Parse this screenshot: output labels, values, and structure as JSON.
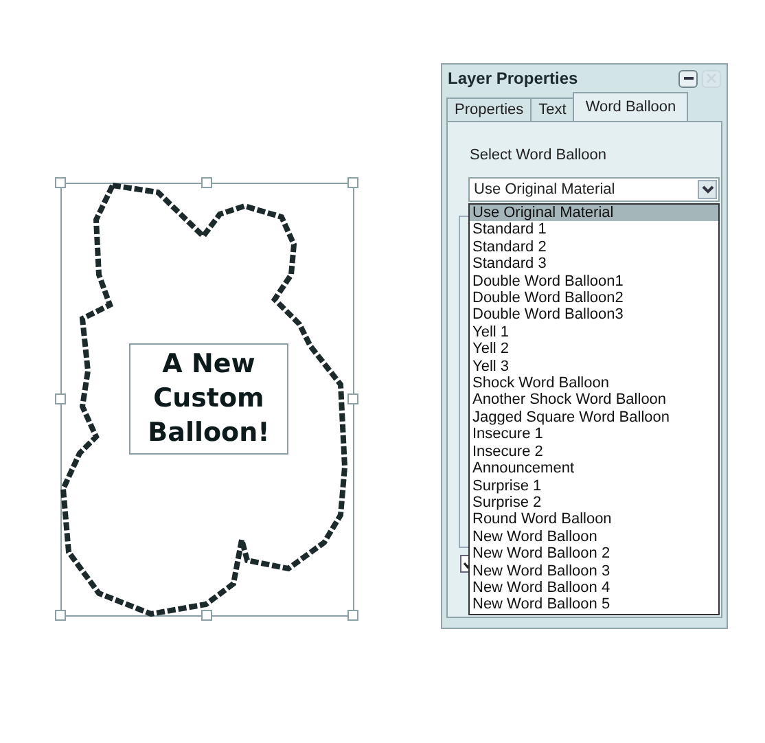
{
  "canvas": {
    "balloon_text": "A New Custom Balloon!"
  },
  "window": {
    "title": "Layer Properties"
  },
  "tabs": [
    {
      "label": "Properties",
      "selected": false
    },
    {
      "label": "Text",
      "selected": false
    },
    {
      "label": "Word Balloon",
      "selected": true
    }
  ],
  "section_label": "Select Word Balloon",
  "dropdown": {
    "value": "Use Original Material"
  },
  "options": [
    {
      "label": "Use Original Material",
      "selected": true
    },
    {
      "label": "Standard 1",
      "selected": false
    },
    {
      "label": "Standard 2",
      "selected": false
    },
    {
      "label": "Standard 3",
      "selected": false
    },
    {
      "label": "Double Word Balloon1",
      "selected": false
    },
    {
      "label": "Double Word Balloon2",
      "selected": false
    },
    {
      "label": "Double Word Balloon3",
      "selected": false
    },
    {
      "label": "Yell 1",
      "selected": false
    },
    {
      "label": "Yell 2",
      "selected": false
    },
    {
      "label": "Yell 3",
      "selected": false
    },
    {
      "label": "Shock Word Balloon",
      "selected": false
    },
    {
      "label": "Another Shock Word Balloon",
      "selected": false
    },
    {
      "label": "Jagged Square Word Balloon",
      "selected": false
    },
    {
      "label": "Insecure 1",
      "selected": false
    },
    {
      "label": "Insecure 2",
      "selected": false
    },
    {
      "label": "Announcement",
      "selected": false
    },
    {
      "label": "Surprise 1",
      "selected": false
    },
    {
      "label": "Surprise 2",
      "selected": false
    },
    {
      "label": "Round Word Balloon",
      "selected": false
    },
    {
      "label": "New Word Balloon",
      "selected": false
    },
    {
      "label": "New Word Balloon 2",
      "selected": false
    },
    {
      "label": "New Word Balloon 3",
      "selected": false
    },
    {
      "label": "New Word Balloon 4",
      "selected": false
    },
    {
      "label": "New Word Balloon 5",
      "selected": false
    }
  ],
  "checkbox": {
    "checked": true
  }
}
